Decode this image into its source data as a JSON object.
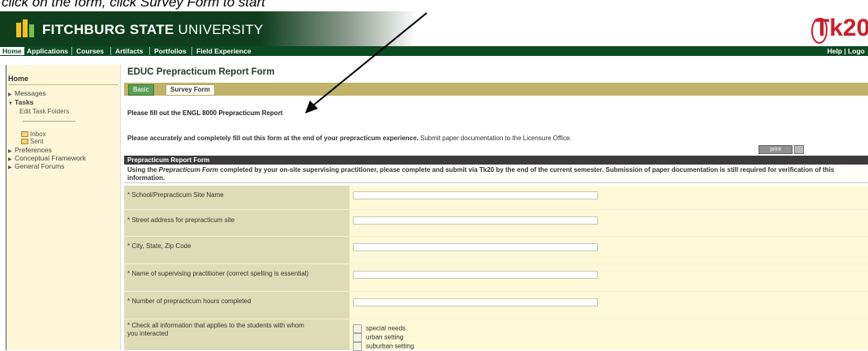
{
  "annotation": {
    "text": "click on the form, click Survey Form to start"
  },
  "header": {
    "brand_bold": "FITCHBURG STATE",
    "brand_light": " UNIVERSITY",
    "product": "Tk20"
  },
  "nav": {
    "tabs": [
      "Home",
      "Applications",
      "Courses",
      "Artifacts",
      "Portfolios",
      "Field Experience"
    ],
    "right": "Help | Logo"
  },
  "sidebar": {
    "heading": "Home",
    "messages": "Messages",
    "tasks": "Tasks",
    "edit_task_folders": "Edit Task Folders",
    "inbox": "Inbox",
    "sent": "Sent",
    "preferences": "Preferences",
    "conceptual_framework": "Conceptual Framework",
    "general_forums": "General Forums"
  },
  "main": {
    "title": "EDUC Prepracticum Report Form",
    "tab_basic": "Basic",
    "tab_survey": "Survey Form",
    "instruction1": "Please fill out the ENGL 8000 Prepracticum Report",
    "instruction2_bold": "Please accurately and completely fill out this form at the end of your prepracticum experience.",
    "instruction2_rest": " Submit paper documentation to the Licensure Office.",
    "print_label": "print",
    "form_header": "Prepracticum Report Form",
    "intro_a": "Using the ",
    "intro_italic": "Prepracticum Form",
    "intro_b": " completed by your on-site supervising practitioner, please complete and submit via Tk20 by the end of the current semester. Submission of paper documentation is still required for verification of this information.",
    "fields": [
      {
        "label": "* School/Prepracticum Site Name",
        "value": ""
      },
      {
        "label": "* Street address for prepracticum site",
        "value": ""
      },
      {
        "label": "* City, State, Zip Code",
        "value": ""
      },
      {
        "label": "* Name of supervising practitioner (correct spelling is essential)",
        "value": ""
      },
      {
        "label": "* Number of prepracticum hours completed",
        "value": ""
      }
    ],
    "checkbox_label": "* Check all information that applies to the students with whom you interacted",
    "checkboxes": [
      "special needs",
      "urban setting",
      "suburban setting"
    ]
  }
}
